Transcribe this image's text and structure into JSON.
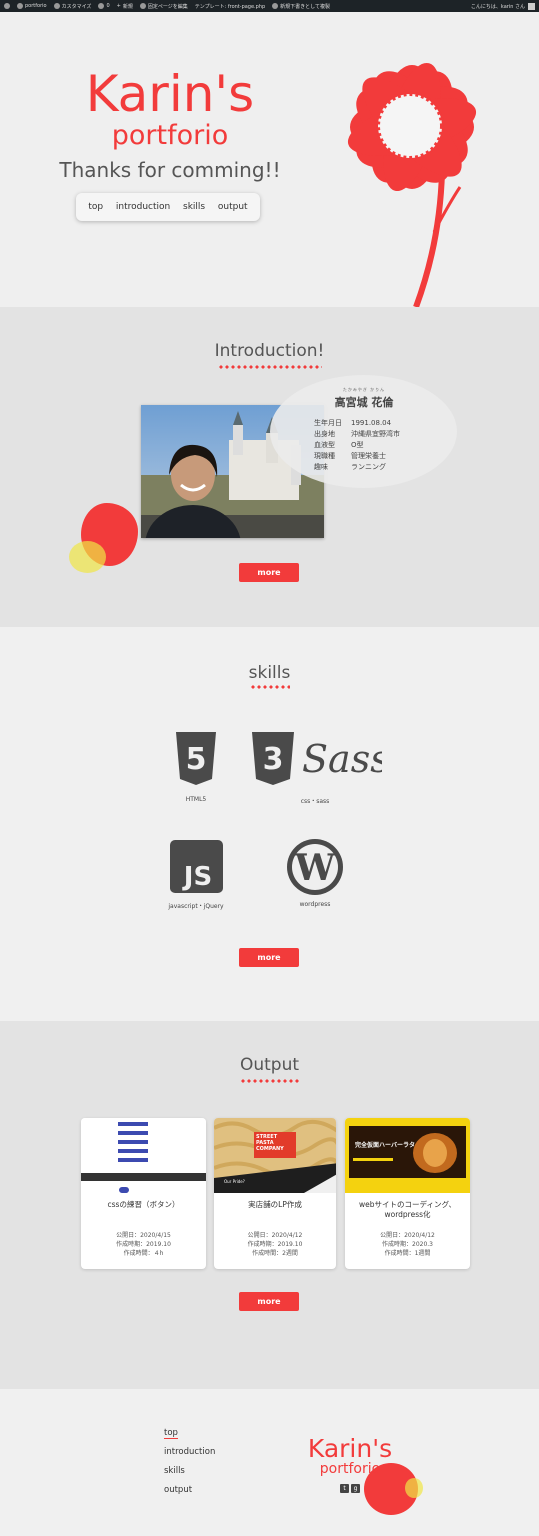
{
  "adminbar": {
    "site": "portforio",
    "customize": "カスタマイズ",
    "comments": "0",
    "new": "新規",
    "edit_page": "固定ページを編集",
    "template": "テンプレート: front-page.php",
    "draft": "新規下書きとして複製",
    "greeting": "こんにちは、karin さん"
  },
  "hero": {
    "title": "Karin's",
    "subtitle": "portforio",
    "thanks": "Thanks for comming!!",
    "nav": [
      "top",
      "introduction",
      "skills",
      "output"
    ]
  },
  "intro": {
    "heading": "Introduction!",
    "kana": "たかみやぎ かりん",
    "name": "高宮城 花倫",
    "profile": [
      {
        "k": "生年月日",
        "v": "1991.08.04"
      },
      {
        "k": "出身地",
        "v": "沖縄県宜野湾市"
      },
      {
        "k": "血液型",
        "v": "O型"
      },
      {
        "k": "現職種",
        "v": "管理栄養士"
      },
      {
        "k": "趣味",
        "v": "ランニング"
      }
    ],
    "more": "more"
  },
  "skills": {
    "heading": "skills",
    "items": [
      {
        "icon": "html5-icon",
        "label": "HTML5"
      },
      {
        "icon": "css3-sass-icon",
        "label": "css・sass"
      },
      {
        "icon": "js-icon",
        "label": "javascript・jQuery"
      },
      {
        "icon": "wordpress-icon",
        "label": "wordpress"
      }
    ],
    "more": "more"
  },
  "output": {
    "heading": "Output",
    "cards": [
      {
        "title": "cssの練習（ボタン）",
        "published": "公開日：2020/4/15",
        "period": "作成時期：2019.10",
        "hours": "作成時間：４h"
      },
      {
        "title": "実店舗のLP作成",
        "published": "公開日：2020/4/12",
        "period": "作成時期：2019.10",
        "hours": "作成時間：2週間"
      },
      {
        "title": "webサイトのコーディング、wordpress化",
        "published": "公開日：2020/4/12",
        "period": "作成時期：2020.3",
        "hours": "作成時間：1週間"
      }
    ],
    "thumb2_text": "STREET PASTA COMPANY",
    "thumb2_sub": "Our Pride?",
    "thumb3_text": "完全仮面ハーバーラタ",
    "more": "more"
  },
  "footer": {
    "nav": [
      "top",
      "introduction",
      "skills",
      "output"
    ],
    "logo": "Karin's",
    "logo_sub": "portforio"
  },
  "colors": {
    "accent": "#f23b3b",
    "yellow": "#f0e646",
    "text": "#444444"
  }
}
